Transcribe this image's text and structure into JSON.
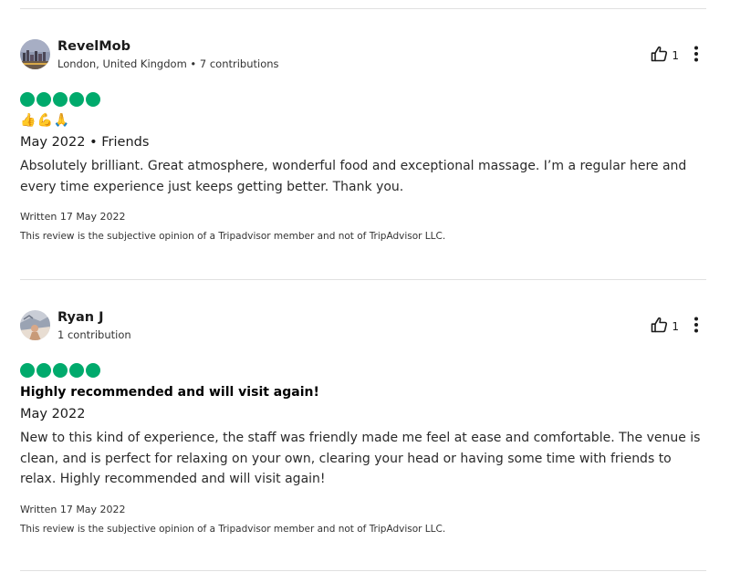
{
  "reviews": [
    {
      "author": "RevelMob",
      "meta": "London, United Kingdom • 7 contributions",
      "helpful_count": "1",
      "rating": 5,
      "emojis": [
        "👍",
        "💪",
        "🙏"
      ],
      "title": "",
      "date_line": "May 2022 • Friends",
      "body": "Absolutely brilliant. Great atmosphere, wonderful food and exceptional massage. I’m a regular here and every time experience just keeps getting better. Thank you.",
      "written": "Written 17 May 2022",
      "disclaimer": "This review is the subjective opinion of a Tripadvisor member and not of TripAdvisor LLC."
    },
    {
      "author": "Ryan J",
      "meta": "1 contribution",
      "helpful_count": "1",
      "rating": 5,
      "title": "Highly recommended and will visit again!",
      "date_line": "May 2022",
      "body": "New to this kind of experience, the staff was friendly made me feel at ease and comfortable. The venue is clean, and is perfect for relaxing on your own, clearing your head or having some time with friends to relax. Highly recommended and will visit again!",
      "written": "Written 17 May 2022",
      "disclaimer": "This review is the subjective opinion of a Tripadvisor member and not of TripAdvisor LLC."
    }
  ],
  "colors": {
    "bubble": "#00aa6c",
    "divider": "#e0e0e0"
  },
  "icons": {
    "helpful": "thumbs-up-icon",
    "more": "more-vertical-icon"
  }
}
